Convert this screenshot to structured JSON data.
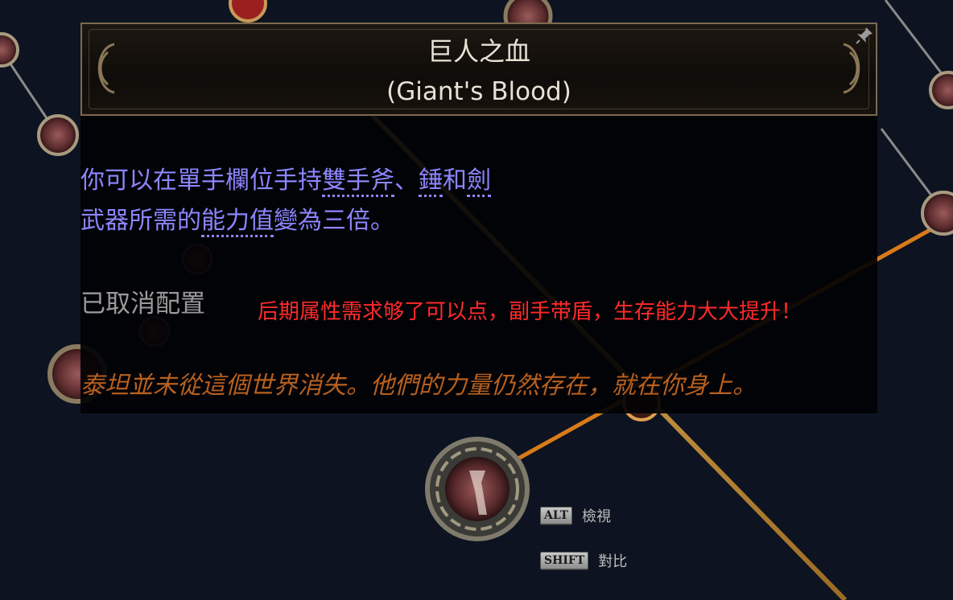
{
  "tooltip": {
    "title_cn": "巨人之血",
    "title_en": "(Giant's Blood)",
    "desc_line1_a": "你可以在單手欄位手持",
    "desc_line1_kw1": "雙手斧",
    "desc_line1_b": "、",
    "desc_line1_kw2": "錘",
    "desc_line1_c": "和",
    "desc_line1_kw3": "劍",
    "desc_line2_a": "武器所需的",
    "desc_line2_kw": "能力值",
    "desc_line2_b": "變為三倍。",
    "status": "已取消配置",
    "note": "后期属性需求够了可以点，副手带盾，生存能力大大提升！",
    "flavor": "泰坦並未從這個世界消失。他們的力量仍然存在，就在你身上。"
  },
  "hints": [
    {
      "key": "ALT",
      "label": "檢視"
    },
    {
      "key": "SHIFT",
      "label": "對比"
    }
  ],
  "colors": {
    "description": "#8c86ff",
    "note": "#ff2a2a",
    "flavor": "#b8601f",
    "status": "#9a9a9a",
    "title": "#e8e2d6"
  }
}
